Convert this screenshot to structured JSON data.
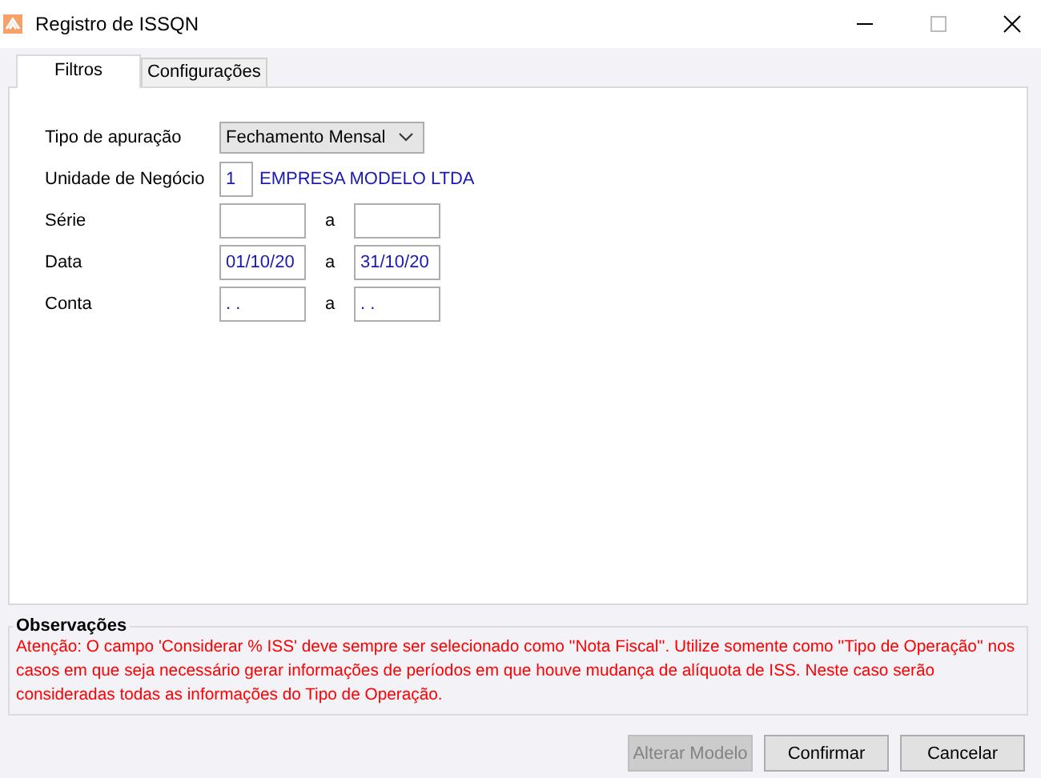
{
  "window": {
    "title": "Registro de ISSQN"
  },
  "tabs": [
    {
      "label": "Filtros",
      "selected": true
    },
    {
      "label": "Configurações",
      "selected": false
    }
  ],
  "form": [
    {
      "kind": "select",
      "label": "Tipo de apuração",
      "value": "Fechamento Mensal"
    },
    {
      "kind": "lookup",
      "label": "Unidade de Negócio",
      "code": "1",
      "description": "EMPRESA MODELO LTDA"
    },
    {
      "kind": "range",
      "label": "Série",
      "separator": "a"
    },
    {
      "kind": "range",
      "label": "Data",
      "from": "01/10/20",
      "separator": "a",
      "to": "31/10/20"
    },
    {
      "kind": "range",
      "label": "Conta",
      "from": ". .",
      "separator": "a",
      "to": ". ."
    }
  ],
  "observations": {
    "title": "Observações",
    "text": "Atenção: O campo 'Considerar % ISS' deve sempre ser selecionado como ''Nota Fiscal''. Utilize somente como ''Tipo de Operação'' nos casos em que seja necessário gerar informações de períodos em que houve mudança de alíquota de ISS. Neste caso serão consideradas todas as informações do Tipo de Operação."
  },
  "buttons": [
    {
      "label": "Alterar Modelo",
      "disabled": true
    },
    {
      "label": "Confirmar",
      "disabled": false
    },
    {
      "label": "Cancelar",
      "disabled": false
    }
  ]
}
